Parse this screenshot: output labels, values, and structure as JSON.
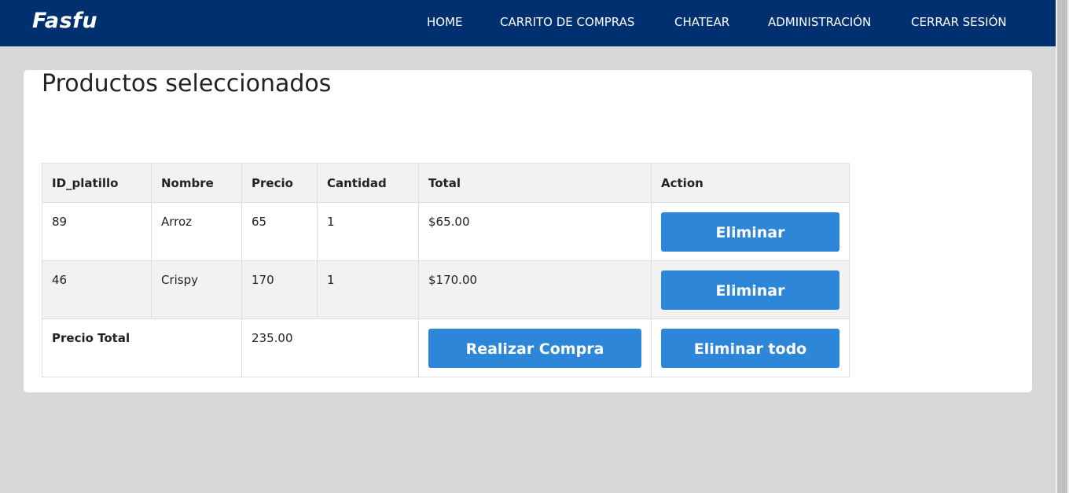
{
  "nav": {
    "brand": "Fasfu",
    "links": [
      "HOME",
      "CARRITO DE COMPRAS",
      "CHATEAR",
      "ADMINISTRACIÓN",
      "CERRAR SESIÓN"
    ]
  },
  "page": {
    "title": "Productos seleccionados"
  },
  "table": {
    "headers": [
      "ID_platillo",
      "Nombre",
      "Precio",
      "Cantidad",
      "Total",
      "Action"
    ],
    "rows": [
      {
        "id": "89",
        "name": "Arroz",
        "price": "65",
        "qty": "1",
        "total": "$65.00",
        "action": "Eliminar"
      },
      {
        "id": "46",
        "name": "Crispy",
        "price": "170",
        "qty": "1",
        "total": "$170.00",
        "action": "Eliminar"
      }
    ],
    "footer": {
      "label": "Precio Total",
      "value": "235.00",
      "buy_button": "Realizar Compra",
      "delete_all_button": "Eliminar todo"
    }
  },
  "colors": {
    "navbar": "#003070",
    "button": "#2e86d8",
    "background": "#d7d8d8"
  }
}
